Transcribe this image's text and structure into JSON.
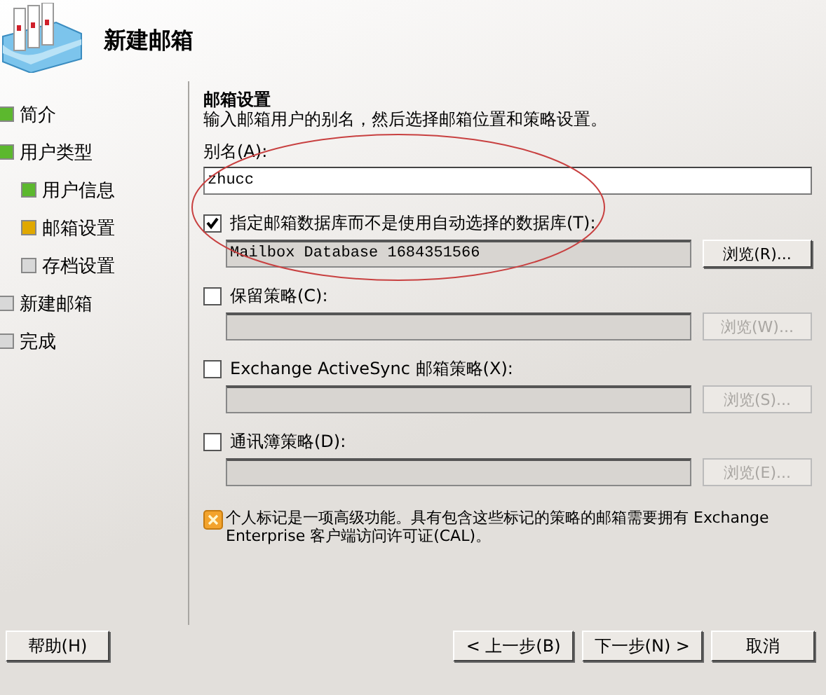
{
  "header": {
    "title": "新建邮箱"
  },
  "steps": [
    {
      "label": "简介",
      "color": "#5cb82e"
    },
    {
      "label": "用户类型",
      "color": "#5cb82e",
      "children": [
        {
          "label": "用户信息",
          "color": "#5cb82e"
        },
        {
          "label": "邮箱设置",
          "color": "#e0a800"
        },
        {
          "label": "存档设置",
          "color": "#d8d8d8"
        }
      ]
    },
    {
      "label": "新建邮箱",
      "color": "#d8d8d8"
    },
    {
      "label": "完成",
      "color": "#d8d8d8"
    }
  ],
  "page": {
    "heading": "邮箱设置",
    "description": "输入邮箱用户的别名，然后选择邮箱位置和策略设置。",
    "alias_label": "别名(A):",
    "alias_value": "zhucc"
  },
  "options": [
    {
      "label": "指定邮箱数据库而不是使用自动选择的数据库(T):",
      "checked": true,
      "value": "Mailbox Database 1684351566",
      "browse": "浏览(R)...",
      "disabled": false
    },
    {
      "label": "保留策略(C):",
      "checked": false,
      "browse": "浏览(W)...",
      "disabled": true
    },
    {
      "label": "Exchange ActiveSync 邮箱策略(X):",
      "checked": false,
      "browse": "浏览(S)...",
      "disabled": true
    },
    {
      "label": "通讯簿策略(D):",
      "checked": false,
      "browse": "浏览(E)...",
      "disabled": true
    }
  ],
  "note": "个人标记是一项高级功能。具有包含这些标记的策略的邮箱需要拥有 Exchange Enterprise 客户端访问许可证(CAL)。",
  "buttons": {
    "help": "帮助(H)",
    "back": "< 上一步(B)",
    "next": "下一步(N) >",
    "cancel": "取消"
  }
}
